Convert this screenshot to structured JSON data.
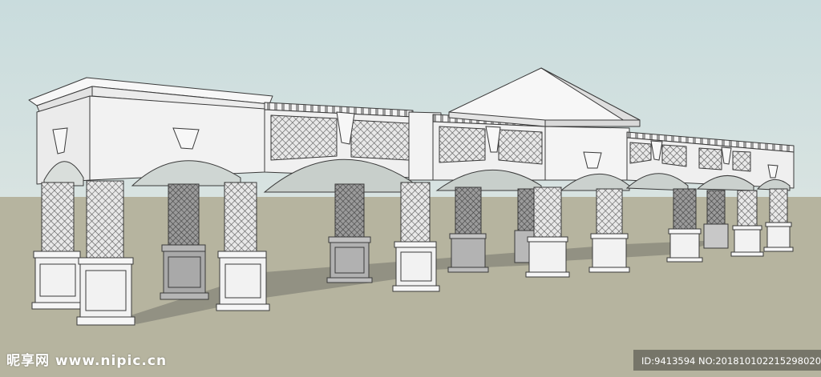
{
  "scene": {
    "subject": "arcade-colonnade-3d-model",
    "sky_color": "#cfdede",
    "ground_color": "#b6b49f",
    "wall_color": "#f2f2f2",
    "line_color": "#3a3a3a",
    "shadow_color": "#8d8c80"
  },
  "watermark": {
    "site_logo": "昵享网 www.nipic.cn",
    "id_line": "ID:9413594 NO:20181010221529802000"
  }
}
